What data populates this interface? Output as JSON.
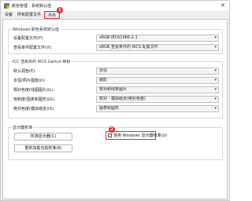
{
  "window": {
    "title": "颜色管理 - 系统默认值",
    "close_glyph": "✕"
  },
  "tabs": [
    {
      "label": "设备",
      "active": false
    },
    {
      "label": "所有配置文件",
      "active": false
    },
    {
      "label": "高级",
      "active": true
    }
  ],
  "badges": {
    "tab": "1",
    "checkbox": "2"
  },
  "windows_defaults": {
    "title": "Windows 颜色系统默认值",
    "rows": [
      {
        "label": "设备配置文件(P):",
        "value": "sRGB IEC61966-2.1"
      },
      {
        "label": "查看条件配置文件(V):",
        "value": "sRGB 查看条件的 WCS 配置文件"
      }
    ]
  },
  "icc_mapping": {
    "title": "ICC 渲染目的 WCS Gamut 映射",
    "rows": [
      {
        "label": "默认调色(E):",
        "value": "永恒"
      },
      {
        "label": "永恒(照片图像)(I):",
        "value": "摄影"
      },
      {
        "label": "相对色度(线图图片)(L):",
        "value": "校对和线条图片"
      },
      {
        "label": "饱和度(图表和图形)(G):",
        "value": "校对 - 模拟纸张(绝对色度)"
      },
      {
        "label": "绝对色度(模拟纸张)(S):",
        "value": "图表和图形"
      }
    ]
  },
  "calibration": {
    "title": "显示器校准",
    "calibrate_button": "校准显示器(C)",
    "reload_button": "重新加载当前校准(R)",
    "checkbox_label": "使用 Windows 显示器校准(U)",
    "checkbox_checked": false
  },
  "colors": {
    "highlight": "#e03030"
  }
}
